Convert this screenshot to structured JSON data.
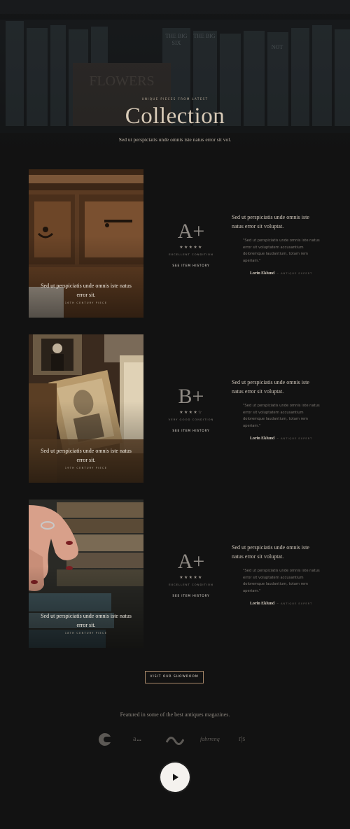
{
  "hero": {
    "kicker": "Unique pieces from latest",
    "title": "Collection",
    "subtitle": "Sed ut perspiciatis unde omnis iste natus error sit vol."
  },
  "items": [
    {
      "caption": "Sed ut perspiciatis unde omnis iste natus error sit.",
      "tag": "16th century piece",
      "grade": "A+",
      "stars": "★★★★★",
      "rating": 5,
      "condition": "Excellent condition",
      "history": "See item history",
      "quote_head": "Sed ut perspiciatis unde omnis iste natus error sit voluptat.",
      "quote_body": "\"Sed ut perspiciatis unde omnis iste natus error sit voluptatem accusantium doloremque laudantium, totam rem aperiam.\"",
      "author": "Lorin Eklund",
      "role": "Antique expert"
    },
    {
      "caption": "Sed ut perspiciatis unde omnis iste natus error sit.",
      "tag": "19th century piece",
      "grade": "B+",
      "stars": "★★★★☆",
      "rating": 4,
      "condition": "Very good condition",
      "history": "See item history",
      "quote_head": "Sed ut perspiciatis unde omnis iste natus error sit voluptat.",
      "quote_body": "\"Sed ut perspiciatis unde omnis iste natus error sit voluptatem accusantium doloremque laudantium, totam rem aperiam.\"",
      "author": "Lorin Eklund",
      "role": "Antique expert"
    },
    {
      "caption": "Sed ut perspiciatis unde omnis iste natus error sit.",
      "tag": "18th century piece",
      "grade": "A+",
      "stars": "★★★★★",
      "rating": 5,
      "condition": "Excellent condition",
      "history": "See item history",
      "quote_head": "Sed ut perspiciatis unde omnis iste natus error sit voluptat.",
      "quote_body": "\"Sed ut perspiciatis unde omnis iste natus error sit voluptatem accusantium doloremque laudantium, totam rem aperiam.\"",
      "author": "Lorin Eklund",
      "role": "Antique expert"
    }
  ],
  "showroom_button": "Visit our showroom",
  "featured_text": "Featured in some of the best antiques magazines.",
  "logos": [
    {
      "name": "c-logo-icon"
    },
    {
      "name": "a-logo",
      "text": "a"
    },
    {
      "name": "wave-logo-icon"
    },
    {
      "name": "script-logo",
      "text": "fabrrenq"
    },
    {
      "name": "rs-logo",
      "text": "r|s"
    }
  ],
  "play_icon": "play-icon",
  "colors": {
    "background": "#121212",
    "accent_border": "#a48668",
    "title": "#d9cbb8"
  }
}
